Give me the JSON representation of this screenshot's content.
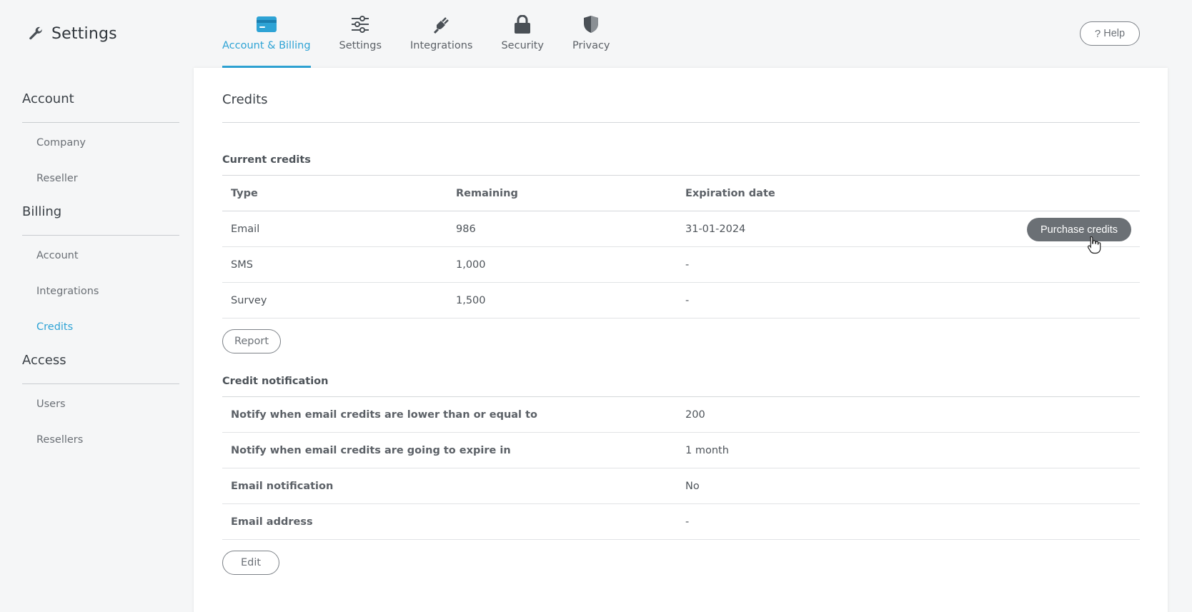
{
  "app": {
    "title": "Settings",
    "icon": "wrench-icon"
  },
  "top_tabs": [
    {
      "label": "Account & Billing",
      "icon": "credit-card-icon",
      "active": true
    },
    {
      "label": "Settings",
      "icon": "sliders-icon",
      "active": false
    },
    {
      "label": "Integrations",
      "icon": "plug-icon",
      "active": false
    },
    {
      "label": "Security",
      "icon": "lock-icon",
      "active": false
    },
    {
      "label": "Privacy",
      "icon": "shield-icon",
      "active": false
    }
  ],
  "help": {
    "label": "Help",
    "icon": "question-icon"
  },
  "sidebar": {
    "sections": [
      {
        "title": "Account",
        "items": [
          {
            "label": "Company"
          },
          {
            "label": "Reseller"
          }
        ]
      },
      {
        "title": "Billing",
        "items": [
          {
            "label": "Account"
          },
          {
            "label": "Integrations"
          },
          {
            "label": "Credits",
            "active": true
          }
        ]
      },
      {
        "title": "Access",
        "items": [
          {
            "label": "Users"
          },
          {
            "label": "Resellers"
          }
        ]
      }
    ]
  },
  "main": {
    "title": "Credits",
    "current_credits": {
      "title": "Current credits",
      "columns": [
        "Type",
        "Remaining",
        "Expiration date"
      ],
      "rows": [
        {
          "type": "Email",
          "remaining": "986",
          "expiration": "31-01-2024"
        },
        {
          "type": "SMS",
          "remaining": "1,000",
          "expiration": "-"
        },
        {
          "type": "Survey",
          "remaining": "1,500",
          "expiration": "-"
        }
      ],
      "purchase_label": "Purchase credits",
      "report_label": "Report"
    },
    "credit_notification": {
      "title": "Credit notification",
      "rows": [
        {
          "label": "Notify when email credits are lower than or equal to",
          "value": "200"
        },
        {
          "label": "Notify when email credits are going to expire in",
          "value": "1 month"
        },
        {
          "label": "Email notification",
          "value": "No"
        },
        {
          "label": "Email address",
          "value": "-"
        }
      ],
      "edit_label": "Edit"
    }
  },
  "colors": {
    "accent": "#2ea3d5",
    "button_dark": "#6b7075",
    "border": "#d4d7da"
  }
}
